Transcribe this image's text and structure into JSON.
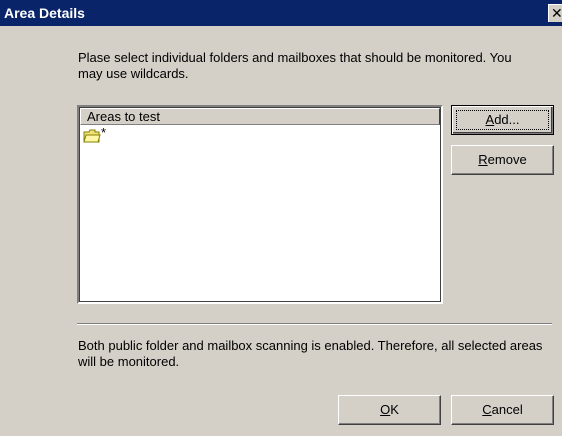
{
  "window": {
    "title": "Area Details",
    "close_glyph": "✕"
  },
  "instructions": "Plase select individual folders and mailboxes that should be monitored. You may use wildcards.",
  "areas_list": {
    "column_header": "Areas to test",
    "items": [
      {
        "icon": "folder-icon",
        "label": "*"
      }
    ]
  },
  "buttons": {
    "add": {
      "mnemonic": "A",
      "rest": "dd..."
    },
    "remove": {
      "mnemonic": "R",
      "rest": "emove"
    },
    "ok": {
      "mnemonic": "O",
      "rest": "K"
    },
    "cancel": {
      "mnemonic": "C",
      "rest": "ancel"
    }
  },
  "status_message": "Both public folder and mailbox scanning is enabled. Therefore, all selected areas will be monitored.",
  "colors": {
    "titlebar": "#0a246a",
    "dialog_face": "#d4d0c8",
    "folder": "#f3e27a"
  }
}
